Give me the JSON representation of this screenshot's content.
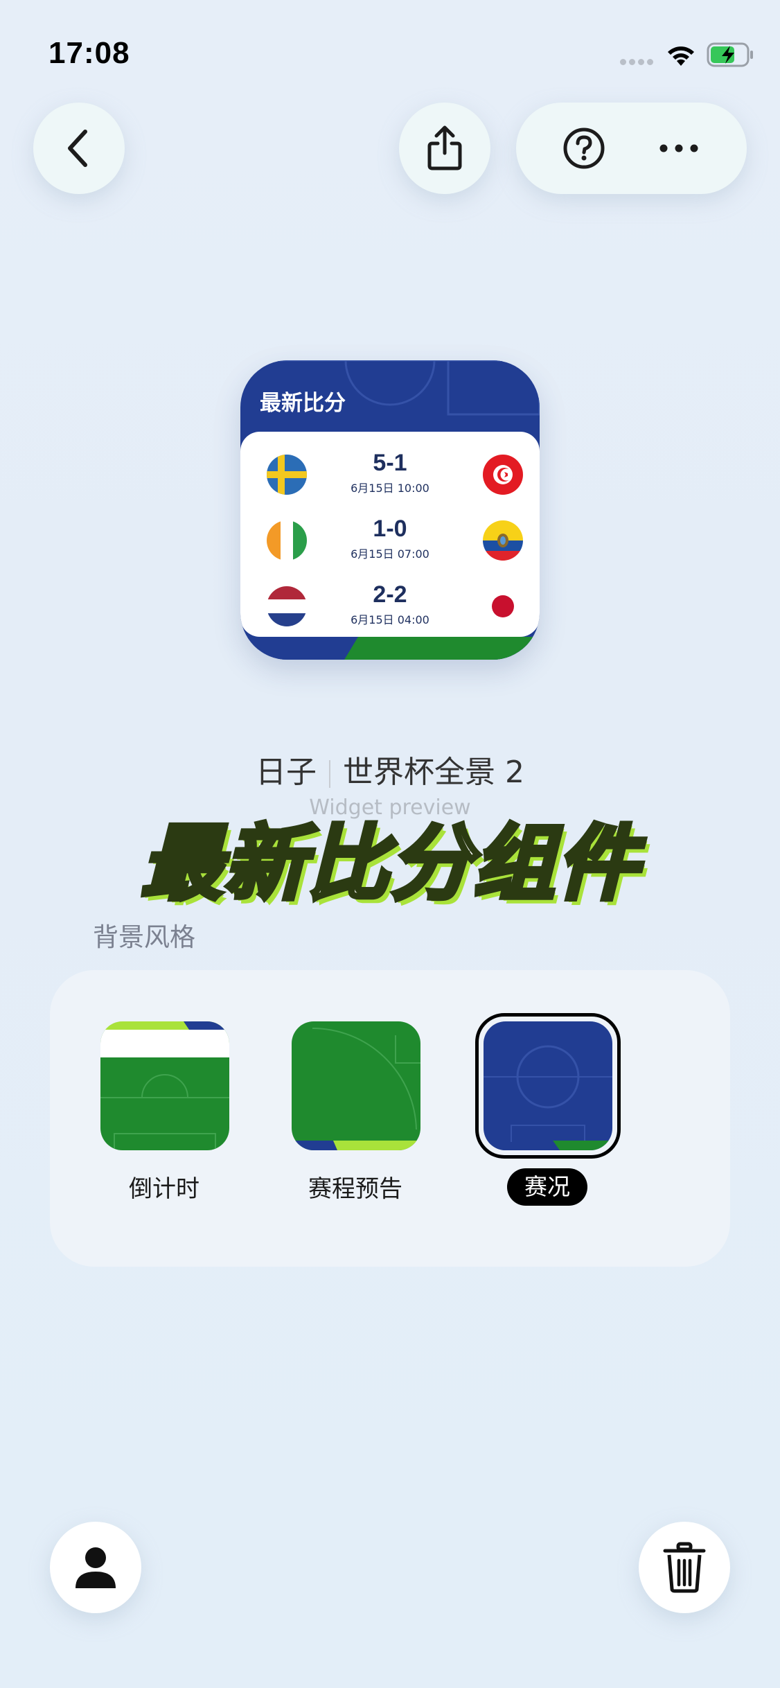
{
  "status_bar": {
    "time": "17:08"
  },
  "nav": {
    "back_icon": "chevron-left-icon",
    "share_icon": "share-icon",
    "help_icon": "question-circle-icon",
    "more_icon": "ellipsis-icon"
  },
  "widget_preview": {
    "title": "最新比分",
    "matches": [
      {
        "home_flag": "sweden-flag",
        "score": "5-1",
        "time": "6月15日 10:00",
        "away_flag": "tunisia-flag"
      },
      {
        "home_flag": "ivory-coast-flag",
        "score": "1-0",
        "time": "6月15日 07:00",
        "away_flag": "ecuador-flag"
      },
      {
        "home_flag": "netherlands-flag",
        "score": "2-2",
        "time": "6月15日 04:00",
        "away_flag": "japan-flag"
      }
    ]
  },
  "widget_info": {
    "app_name": "日子",
    "widget_name": "世界杯全景 2",
    "subtitle": "Widget preview"
  },
  "overlay_title": "最新比分组件",
  "background_style": {
    "section_label": "背景风格",
    "options": [
      {
        "label": "倒计时",
        "selected": false
      },
      {
        "label": "赛程预告",
        "selected": false
      },
      {
        "label": "赛况",
        "selected": true
      }
    ]
  },
  "bottom_bar": {
    "avatar_icon": "person-icon",
    "delete_icon": "trash-icon"
  },
  "colors": {
    "widget_blue": "#213d92",
    "pitch_green": "#1f8a2e",
    "accent_lime": "#a9e23a",
    "score_text": "#1e2f5e"
  }
}
